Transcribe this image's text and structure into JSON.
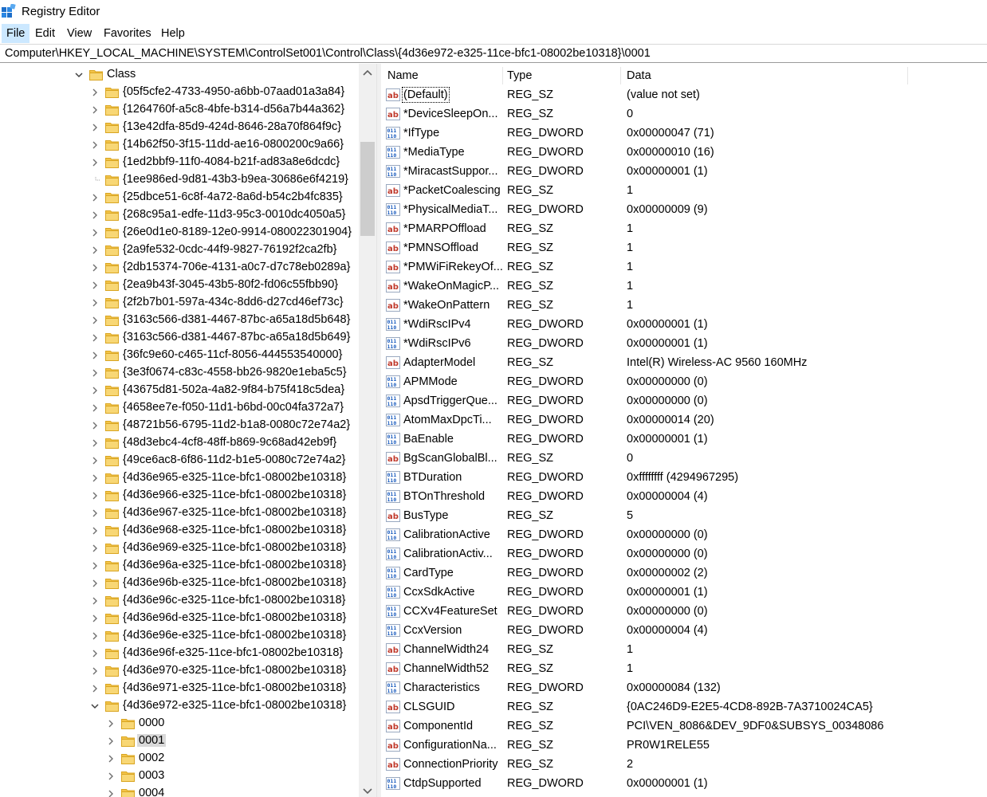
{
  "window": {
    "title": "Registry Editor"
  },
  "menu": [
    {
      "label": "File",
      "active": true
    },
    {
      "label": "Edit"
    },
    {
      "label": "View"
    },
    {
      "label": "Favorites"
    },
    {
      "label": "Help"
    }
  ],
  "address": "Computer\\HKEY_LOCAL_MACHINE\\SYSTEM\\ControlSet001\\Control\\Class\\{4d36e972-e325-11ce-bfc1-08002be10318}\\0001",
  "tree": [
    {
      "label": "Class",
      "level": 0,
      "expanded": true
    },
    {
      "label": "{05f5cfe2-4733-4950-a6bb-07aad01a3a84}",
      "level": 1
    },
    {
      "label": "{1264760f-a5c8-4bfe-b314-d56a7b44a362}",
      "level": 1
    },
    {
      "label": "{13e42dfa-85d9-424d-8646-28a70f864f9c}",
      "level": 1
    },
    {
      "label": "{14b62f50-3f15-11dd-ae16-0800200c9a66}",
      "level": 1
    },
    {
      "label": "{1ed2bbf9-11f0-4084-b21f-ad83a8e6dcdc}",
      "level": 1
    },
    {
      "label": "{1ee986ed-9d81-43b3-b9ea-30686e6f4219}",
      "level": 1,
      "noexpand": true
    },
    {
      "label": "{25dbce51-6c8f-4a72-8a6d-b54c2b4fc835}",
      "level": 1
    },
    {
      "label": "{268c95a1-edfe-11d3-95c3-0010dc4050a5}",
      "level": 1
    },
    {
      "label": "{26e0d1e0-8189-12e0-9914-080022301904}",
      "level": 1
    },
    {
      "label": "{2a9fe532-0cdc-44f9-9827-76192f2ca2fb}",
      "level": 1
    },
    {
      "label": "{2db15374-706e-4131-a0c7-d7c78eb0289a}",
      "level": 1
    },
    {
      "label": "{2ea9b43f-3045-43b5-80f2-fd06c55fbb90}",
      "level": 1
    },
    {
      "label": "{2f2b7b01-597a-434c-8dd6-d27cd46ef73c}",
      "level": 1
    },
    {
      "label": "{3163c566-d381-4467-87bc-a65a18d5b648}",
      "level": 1
    },
    {
      "label": "{3163c566-d381-4467-87bc-a65a18d5b649}",
      "level": 1
    },
    {
      "label": "{36fc9e60-c465-11cf-8056-444553540000}",
      "level": 1
    },
    {
      "label": "{3e3f0674-c83c-4558-bb26-9820e1eba5c5}",
      "level": 1
    },
    {
      "label": "{43675d81-502a-4a82-9f84-b75f418c5dea}",
      "level": 1
    },
    {
      "label": "{4658ee7e-f050-11d1-b6bd-00c04fa372a7}",
      "level": 1
    },
    {
      "label": "{48721b56-6795-11d2-b1a8-0080c72e74a2}",
      "level": 1
    },
    {
      "label": "{48d3ebc4-4cf8-48ff-b869-9c68ad42eb9f}",
      "level": 1
    },
    {
      "label": "{49ce6ac8-6f86-11d2-b1e5-0080c72e74a2}",
      "level": 1
    },
    {
      "label": "{4d36e965-e325-11ce-bfc1-08002be10318}",
      "level": 1
    },
    {
      "label": "{4d36e966-e325-11ce-bfc1-08002be10318}",
      "level": 1
    },
    {
      "label": "{4d36e967-e325-11ce-bfc1-08002be10318}",
      "level": 1
    },
    {
      "label": "{4d36e968-e325-11ce-bfc1-08002be10318}",
      "level": 1
    },
    {
      "label": "{4d36e969-e325-11ce-bfc1-08002be10318}",
      "level": 1
    },
    {
      "label": "{4d36e96a-e325-11ce-bfc1-08002be10318}",
      "level": 1
    },
    {
      "label": "{4d36e96b-e325-11ce-bfc1-08002be10318}",
      "level": 1
    },
    {
      "label": "{4d36e96c-e325-11ce-bfc1-08002be10318}",
      "level": 1
    },
    {
      "label": "{4d36e96d-e325-11ce-bfc1-08002be10318}",
      "level": 1
    },
    {
      "label": "{4d36e96e-e325-11ce-bfc1-08002be10318}",
      "level": 1
    },
    {
      "label": "{4d36e96f-e325-11ce-bfc1-08002be10318}",
      "level": 1
    },
    {
      "label": "{4d36e970-e325-11ce-bfc1-08002be10318}",
      "level": 1
    },
    {
      "label": "{4d36e971-e325-11ce-bfc1-08002be10318}",
      "level": 1
    },
    {
      "label": "{4d36e972-e325-11ce-bfc1-08002be10318}",
      "level": 1,
      "expanded": true
    },
    {
      "label": "0000",
      "level": 2
    },
    {
      "label": "0001",
      "level": 2,
      "selected": true
    },
    {
      "label": "0002",
      "level": 2
    },
    {
      "label": "0003",
      "level": 2
    },
    {
      "label": "0004",
      "level": 2
    }
  ],
  "columns": {
    "name": "Name",
    "type": "Type",
    "data": "Data"
  },
  "values": [
    {
      "name": "(Default)",
      "type": "REG_SZ",
      "data": "(value not set)",
      "focused": true
    },
    {
      "name": "*DeviceSleepOn...",
      "type": "REG_SZ",
      "data": "0"
    },
    {
      "name": "*IfType",
      "type": "REG_DWORD",
      "data": "0x00000047 (71)"
    },
    {
      "name": "*MediaType",
      "type": "REG_DWORD",
      "data": "0x00000010 (16)"
    },
    {
      "name": "*MiracastSuppor...",
      "type": "REG_DWORD",
      "data": "0x00000001 (1)"
    },
    {
      "name": "*PacketCoalescing",
      "type": "REG_SZ",
      "data": "1"
    },
    {
      "name": "*PhysicalMediaT...",
      "type": "REG_DWORD",
      "data": "0x00000009 (9)"
    },
    {
      "name": "*PMARPOffload",
      "type": "REG_SZ",
      "data": "1"
    },
    {
      "name": "*PMNSOffload",
      "type": "REG_SZ",
      "data": "1"
    },
    {
      "name": "*PMWiFiRekeyOf...",
      "type": "REG_SZ",
      "data": "1"
    },
    {
      "name": "*WakeOnMagicP...",
      "type": "REG_SZ",
      "data": "1"
    },
    {
      "name": "*WakeOnPattern",
      "type": "REG_SZ",
      "data": "1"
    },
    {
      "name": "*WdiRscIPv4",
      "type": "REG_DWORD",
      "data": "0x00000001 (1)"
    },
    {
      "name": "*WdiRscIPv6",
      "type": "REG_DWORD",
      "data": "0x00000001 (1)"
    },
    {
      "name": "AdapterModel",
      "type": "REG_SZ",
      "data": "Intel(R) Wireless-AC 9560 160MHz"
    },
    {
      "name": "APMMode",
      "type": "REG_DWORD",
      "data": "0x00000000 (0)"
    },
    {
      "name": "ApsdTriggerQue...",
      "type": "REG_DWORD",
      "data": "0x00000000 (0)"
    },
    {
      "name": "AtomMaxDpcTi...",
      "type": "REG_DWORD",
      "data": "0x00000014 (20)"
    },
    {
      "name": "BaEnable",
      "type": "REG_DWORD",
      "data": "0x00000001 (1)"
    },
    {
      "name": "BgScanGlobalBl...",
      "type": "REG_SZ",
      "data": "0"
    },
    {
      "name": "BTDuration",
      "type": "REG_DWORD",
      "data": "0xffffffff (4294967295)"
    },
    {
      "name": "BTOnThreshold",
      "type": "REG_DWORD",
      "data": "0x00000004 (4)"
    },
    {
      "name": "BusType",
      "type": "REG_SZ",
      "data": "5"
    },
    {
      "name": "CalibrationActive",
      "type": "REG_DWORD",
      "data": "0x00000000 (0)"
    },
    {
      "name": "CalibrationActiv...",
      "type": "REG_DWORD",
      "data": "0x00000000 (0)"
    },
    {
      "name": "CardType",
      "type": "REG_DWORD",
      "data": "0x00000002 (2)"
    },
    {
      "name": "CcxSdkActive",
      "type": "REG_DWORD",
      "data": "0x00000001 (1)"
    },
    {
      "name": "CCXv4FeatureSet",
      "type": "REG_DWORD",
      "data": "0x00000000 (0)"
    },
    {
      "name": "CcxVersion",
      "type": "REG_DWORD",
      "data": "0x00000004 (4)"
    },
    {
      "name": "ChannelWidth24",
      "type": "REG_SZ",
      "data": "1"
    },
    {
      "name": "ChannelWidth52",
      "type": "REG_SZ",
      "data": "1"
    },
    {
      "name": "Characteristics",
      "type": "REG_DWORD",
      "data": "0x00000084 (132)"
    },
    {
      "name": "CLSGUID",
      "type": "REG_SZ",
      "data": "{0AC246D9-E2E5-4CD8-892B-7A3710024CA5}"
    },
    {
      "name": "ComponentId",
      "type": "REG_SZ",
      "data": "PCI\\VEN_8086&DEV_9DF0&SUBSYS_00348086"
    },
    {
      "name": "ConfigurationNa...",
      "type": "REG_SZ",
      "data": "PR0W1RELE55"
    },
    {
      "name": "ConnectionPriority",
      "type": "REG_SZ",
      "data": "2"
    },
    {
      "name": "CtdpSupported",
      "type": "REG_DWORD",
      "data": "0x00000001 (1)"
    }
  ]
}
